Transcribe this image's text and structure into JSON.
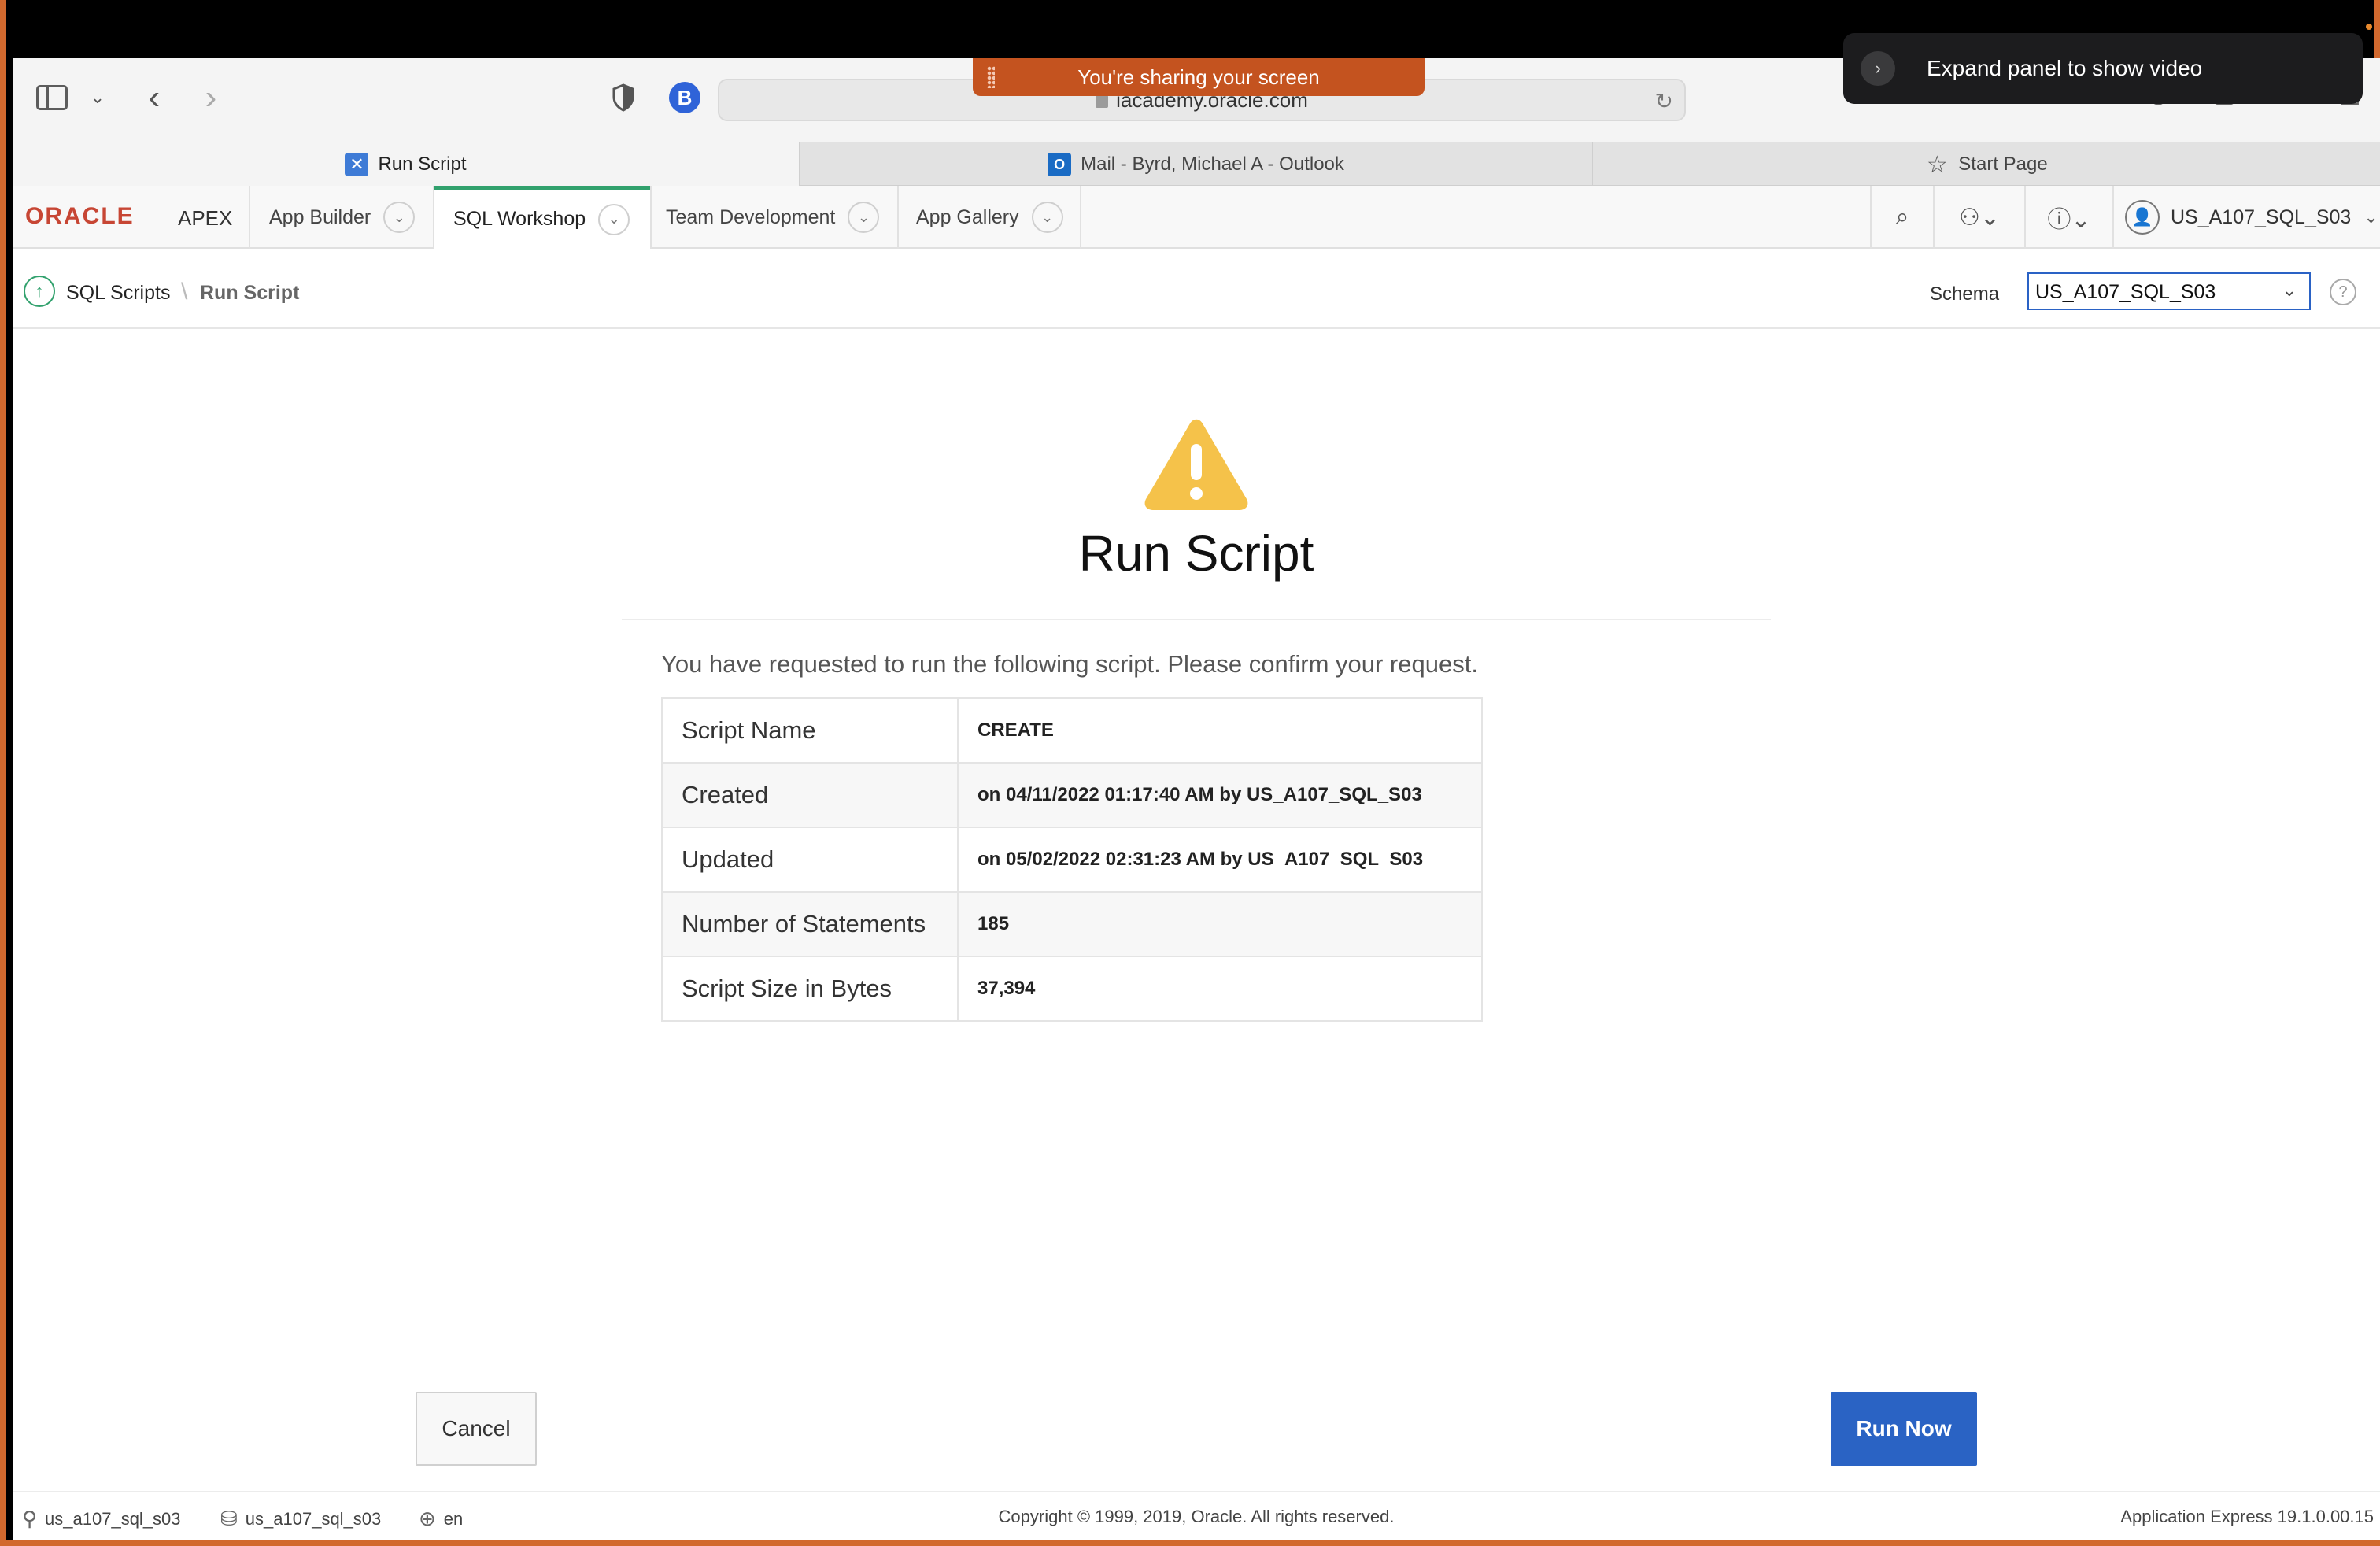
{
  "browser": {
    "address": "iacademy.oracle.com",
    "share_banner": "You're sharing your screen",
    "ext_badge": "B",
    "tabs": [
      {
        "label": "Run Script"
      },
      {
        "label": "Mail - Byrd, Michael A - Outlook"
      },
      {
        "label": "Start Page"
      }
    ]
  },
  "notification": {
    "text": "Expand panel to show video"
  },
  "apex": {
    "logo": "ORACLE",
    "logo_suffix": "APEX",
    "nav": [
      {
        "label": "App Builder"
      },
      {
        "label": "SQL Workshop"
      },
      {
        "label": "Team Development"
      },
      {
        "label": "App Gallery"
      }
    ],
    "user": "US_A107_SQL_S03"
  },
  "breadcrumb": {
    "parent": "SQL Scripts",
    "current": "Run Script",
    "schema_label": "Schema",
    "schema_value": "US_A107_SQL_S03"
  },
  "main": {
    "title": "Run Script",
    "confirm_text": "You have requested to run the following script. Please confirm your request.",
    "details": [
      {
        "label": "Script Name",
        "value": "CREATE"
      },
      {
        "label": "Created",
        "value": "on 04/11/2022 01:17:40 AM by US_A107_SQL_S03"
      },
      {
        "label": "Updated",
        "value": "on 05/02/2022 02:31:23 AM by US_A107_SQL_S03"
      },
      {
        "label": "Number of Statements",
        "value": "185"
      },
      {
        "label": "Script Size in Bytes",
        "value": "37,394"
      }
    ],
    "cancel_label": "Cancel",
    "run_label": "Run Now"
  },
  "footer": {
    "user": "us_a107_sql_s03",
    "schema": "us_a107_sql_s03",
    "language": "en",
    "copyright": "Copyright © 1999, 2019, Oracle. All rights reserved.",
    "version": "Application Express 19.1.0.00.15"
  },
  "colors": {
    "accent": "#2a63c4",
    "oracle_red": "#c74634",
    "active_tab_green": "#31a16d",
    "warning": "#f5c24a",
    "share_banner": "#c4531f"
  }
}
